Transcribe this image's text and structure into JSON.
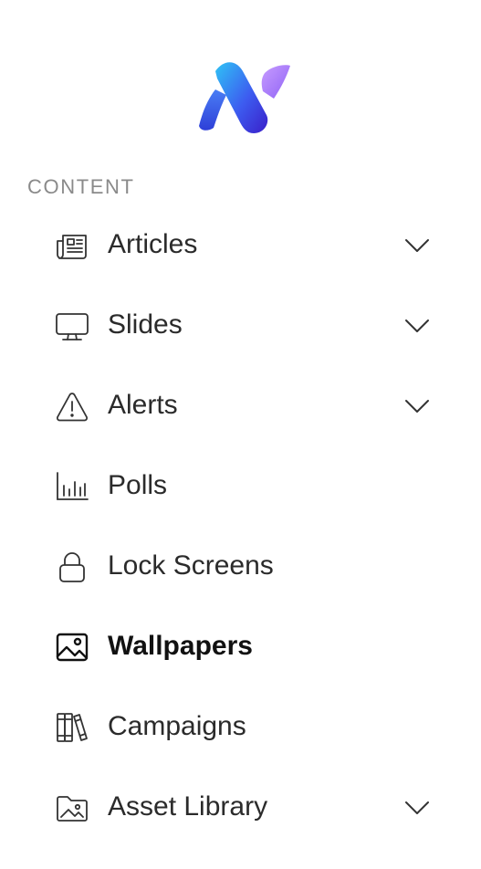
{
  "sidebar": {
    "logo_icon": "brand-n-logo",
    "section_label": "CONTENT",
    "items": [
      {
        "label": "Articles",
        "icon": "newspaper-icon",
        "expandable": true,
        "active": false
      },
      {
        "label": "Slides",
        "icon": "monitor-icon",
        "expandable": true,
        "active": false
      },
      {
        "label": "Alerts",
        "icon": "warning-icon",
        "expandable": true,
        "active": false
      },
      {
        "label": "Polls",
        "icon": "bar-chart-icon",
        "expandable": false,
        "active": false
      },
      {
        "label": "Lock Screens",
        "icon": "lock-icon",
        "expandable": false,
        "active": false
      },
      {
        "label": "Wallpapers",
        "icon": "image-icon",
        "expandable": false,
        "active": true
      },
      {
        "label": "Campaigns",
        "icon": "library-books-icon",
        "expandable": false,
        "active": false
      },
      {
        "label": "Asset Library",
        "icon": "folder-image-icon",
        "expandable": true,
        "active": false
      }
    ]
  },
  "colors": {
    "logo_gradient_start": "#2fc3f5",
    "logo_gradient_mid": "#3d5cf0",
    "logo_gradient_end": "#3a1fc9",
    "logo_accent": "#b58af8",
    "section_label": "#8a8a8a",
    "text": "#2b2b2b",
    "active_text": "#111111"
  }
}
